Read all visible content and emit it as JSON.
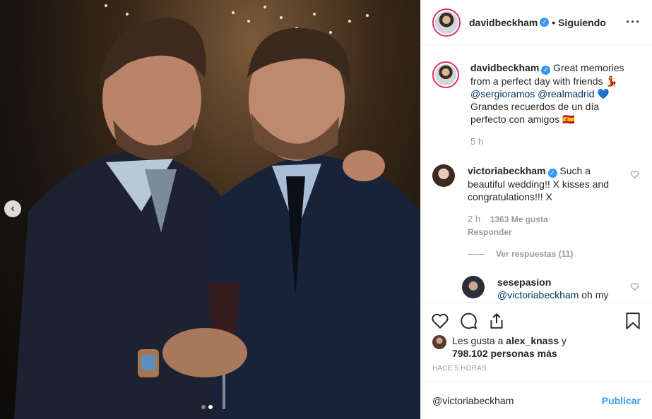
{
  "post": {
    "header": {
      "username": "davidbeckham",
      "separator": "•",
      "follow_label": "Siguiendo",
      "more_icon": "ellipsis-icon"
    },
    "caption": {
      "username": "davidbeckham",
      "text_1": "Great memories from a perfect day with friends",
      "emoji_1": "💃",
      "mention_1": "@sergioramos",
      "mention_2": "@realmadrid",
      "emoji_2": "💙",
      "text_2": "Grandes recuerdos de un día perfecto con amigos",
      "emoji_3": "🇪🇸",
      "time": "5 h"
    },
    "comments": [
      {
        "username": "victoriabeckham",
        "text": "Such a beautiful wedding!! X kisses and congratulations!!! X",
        "time": "2 h",
        "likes": "1363 Me gusta",
        "reply_label": "Responder"
      }
    ],
    "view_replies": "Ver respuestas (11)",
    "reply": {
      "username": "sesepasion",
      "mention": "@victoriabeckham",
      "text": "oh my"
    },
    "likes": {
      "prefix": "Les gusta a",
      "user": "alex_knass",
      "connector": "y",
      "count": "798.102 personas más"
    },
    "timestamp": "HACE 5 HORAS",
    "composer": {
      "value": "@victoriabeckham",
      "publish_label": "Publicar"
    },
    "carousel": {
      "current": 2,
      "total": 2,
      "prev_label": "‹"
    }
  },
  "colors": {
    "accent": "#3897f0",
    "verified": "#3897f0",
    "story_ring": "#e1306c",
    "muted": "#999999",
    "link": "#003569"
  }
}
